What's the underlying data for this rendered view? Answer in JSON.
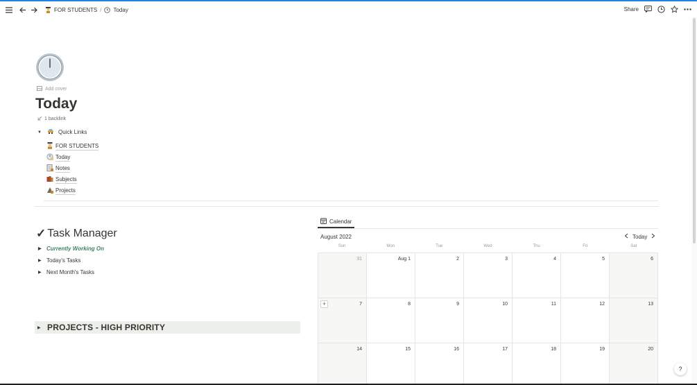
{
  "colors": {
    "accent": "#2383e2",
    "text": "#37352f",
    "muted": "#9b9a97",
    "green": "#448361",
    "calloutBg": "#ecefea"
  },
  "topbar": {
    "breadcrumb": [
      {
        "label": "FOR STUDENTS",
        "icon": "student-emoji-icon"
      },
      {
        "label": "Today",
        "icon": "clock-icon"
      }
    ],
    "separator": "/",
    "share_label": "Share",
    "icons": [
      "menu-icon",
      "back-arrow-icon",
      "forward-arrow-icon",
      "comment-icon",
      "clock-history-icon",
      "star-icon",
      "more-icon"
    ]
  },
  "page": {
    "icon": "clock-icon",
    "add_cover_label": "Add cover",
    "title": "Today",
    "backlink_label": "1 backlink"
  },
  "quick_links": {
    "label": "Quick Links",
    "items": [
      {
        "label": "FOR STUDENTS",
        "icon": "student-emoji-icon"
      },
      {
        "label": "Today",
        "icon": "clock-emoji-icon"
      },
      {
        "label": "Notes",
        "icon": "notes-emoji-icon"
      },
      {
        "label": "Subjects",
        "icon": "books-emoji-icon"
      },
      {
        "label": "Projects",
        "icon": "projects-emoji-icon"
      }
    ]
  },
  "task_manager": {
    "check": "✓",
    "title": "Task Manager",
    "rows": [
      {
        "label": "Currently Working On"
      },
      {
        "label": "Today's Tasks"
      },
      {
        "label": "Next Month's Tasks"
      }
    ]
  },
  "projects_toggle": {
    "label": "PROJECTS - HIGH PRIORITY"
  },
  "calendar": {
    "tab_label": "Calendar",
    "month_label": "August 2022",
    "today_label": "Today",
    "weekdays": [
      "Sun",
      "Mon",
      "Tue",
      "Wed",
      "Thu",
      "Fri",
      "Sat"
    ],
    "weeks": [
      [
        "31",
        "Aug 1",
        "2",
        "3",
        "4",
        "5",
        "6"
      ],
      [
        "7",
        "8",
        "9",
        "10",
        "11",
        "12",
        "13"
      ],
      [
        "14",
        "15",
        "16",
        "17",
        "18",
        "19",
        "20"
      ]
    ]
  },
  "help_label": "?"
}
